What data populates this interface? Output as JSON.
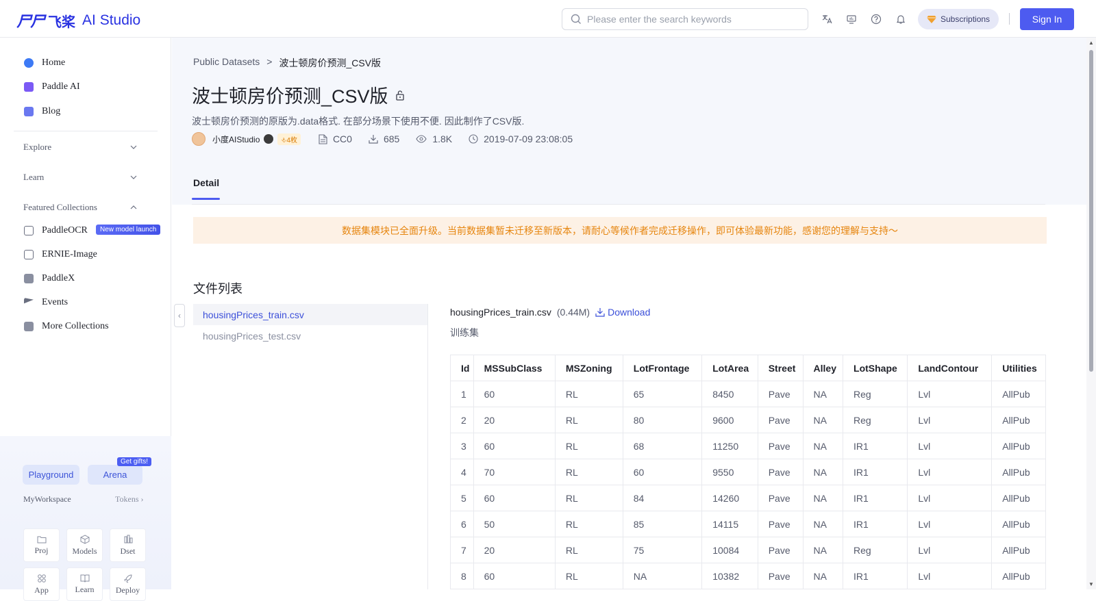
{
  "header": {
    "logo_mark": "⼫⼫",
    "logo_cn": "飞桨",
    "logo_text": "AI Studio",
    "search_placeholder": "Please enter the search keywords",
    "subscriptions": "Subscriptions",
    "sign_in": "Sign In"
  },
  "sidebar": {
    "top_items": [
      {
        "label": "Home",
        "color": "#3d7af5"
      },
      {
        "label": "Paddle AI",
        "color": "#7b5af5"
      },
      {
        "label": "Blog",
        "color": "#6a78f0"
      }
    ],
    "sections": [
      "Explore",
      "Learn",
      "Featured Collections"
    ],
    "collections": [
      {
        "label": "PaddleOCR",
        "color": "#6a6f80"
      },
      {
        "label": "ERNIE-Image",
        "color": "#6a6f80"
      },
      {
        "label": "PaddleX",
        "color": "#6a6f80"
      },
      {
        "label": "Events",
        "color": "#6a6f80"
      },
      {
        "label": "More Collections",
        "color": "#6a6f80"
      }
    ],
    "new_badge": "New model launch",
    "playground": "Playground",
    "arena": "Arena",
    "gift_badge": "Get gifts!",
    "workspace_label": "MyWorkspace",
    "tokens": "Tokens",
    "tiles": [
      "Proj",
      "Models",
      "Dset",
      "App",
      "Learn",
      "Deploy"
    ]
  },
  "page": {
    "breadcrumb_root": "Public Datasets",
    "breadcrumb_sep": ">",
    "breadcrumb_current": "波士顿房价预测_CSV版",
    "title": "波士顿房价预测_CSV版",
    "description": "波士顿房价预测的原版为.data格式. 在部分场景下使用不便. 因此制作了CSV版.",
    "author": "小度AIStudio",
    "level": "⎀4枚",
    "license": "CC0",
    "downloads": "685",
    "views": "1.8K",
    "date": "2019-07-09 23:08:05",
    "tab": "Detail",
    "notice": "数据集模块已全面升级。当前数据集暂未迁移至新版本，请耐心等候作者完成迁移操作，即可体验最新功能，感谢您的理解与支持～",
    "files_title": "文件列表",
    "files": [
      "housingPrices_train.csv",
      "housingPrices_test.csv"
    ],
    "preview_file": "housingPrices_train.csv",
    "preview_size": "(0.44M)",
    "download": "Download",
    "preview_sub": "训练集"
  },
  "table": {
    "columns": [
      "Id",
      "MSSubClass",
      "MSZoning",
      "LotFrontage",
      "LotArea",
      "Street",
      "Alley",
      "LotShape",
      "LandContour",
      "Utilities"
    ],
    "rows": [
      [
        "1",
        "60",
        "RL",
        "65",
        "8450",
        "Pave",
        "NA",
        "Reg",
        "Lvl",
        "AllPub"
      ],
      [
        "2",
        "20",
        "RL",
        "80",
        "9600",
        "Pave",
        "NA",
        "Reg",
        "Lvl",
        "AllPub"
      ],
      [
        "3",
        "60",
        "RL",
        "68",
        "11250",
        "Pave",
        "NA",
        "IR1",
        "Lvl",
        "AllPub"
      ],
      [
        "4",
        "70",
        "RL",
        "60",
        "9550",
        "Pave",
        "NA",
        "IR1",
        "Lvl",
        "AllPub"
      ],
      [
        "5",
        "60",
        "RL",
        "84",
        "14260",
        "Pave",
        "NA",
        "IR1",
        "Lvl",
        "AllPub"
      ],
      [
        "6",
        "50",
        "RL",
        "85",
        "14115",
        "Pave",
        "NA",
        "IR1",
        "Lvl",
        "AllPub"
      ],
      [
        "7",
        "20",
        "RL",
        "75",
        "10084",
        "Pave",
        "NA",
        "Reg",
        "Lvl",
        "AllPub"
      ],
      [
        "8",
        "60",
        "RL",
        "NA",
        "10382",
        "Pave",
        "NA",
        "IR1",
        "Lvl",
        "AllPub"
      ]
    ]
  }
}
